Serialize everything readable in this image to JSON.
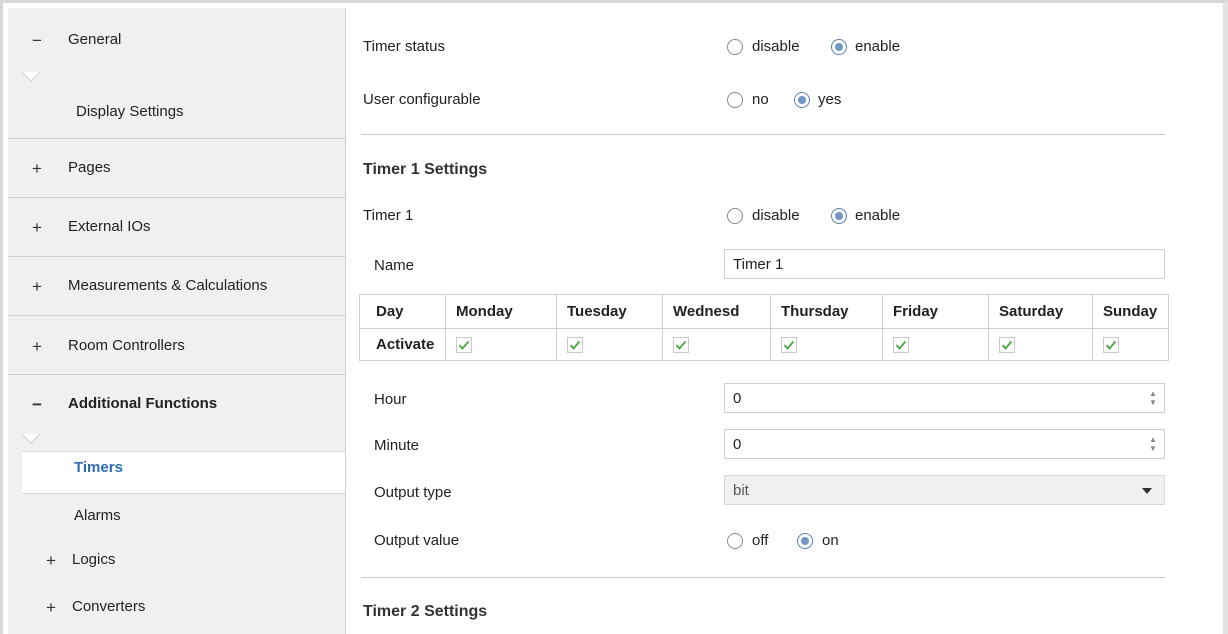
{
  "sidebar": {
    "items": [
      {
        "symbol": "−",
        "label": "General"
      },
      {
        "symbol": "",
        "label": "Display Settings"
      },
      {
        "symbol": "+",
        "label": "Pages"
      },
      {
        "symbol": "+",
        "label": "External IOs"
      },
      {
        "symbol": "+",
        "label": "Measurements & Calculations"
      },
      {
        "symbol": "+",
        "label": "Room Controllers"
      },
      {
        "symbol": "−",
        "label": "Additional Functions"
      },
      {
        "symbol": "",
        "label": "Timers"
      },
      {
        "symbol": "",
        "label": "Alarms"
      },
      {
        "symbol": "+",
        "label": "Logics"
      },
      {
        "symbol": "+",
        "label": "Converters"
      }
    ],
    "selected": "Timers"
  },
  "main": {
    "timer_status": {
      "label": "Timer status",
      "opt_a": "disable",
      "opt_b": "enable",
      "selected": "enable"
    },
    "user_configurable": {
      "label": "User configurable",
      "opt_a": "no",
      "opt_b": "yes",
      "selected": "yes"
    },
    "timer1_section": "Timer 1 Settings",
    "timer1": {
      "label": "Timer 1",
      "opt_a": "disable",
      "opt_b": "enable",
      "selected": "enable"
    },
    "name": {
      "label": "Name",
      "value": "Timer 1"
    },
    "days_table": {
      "headers": [
        "Day",
        "Monday",
        "Tuesday",
        "Wednesd",
        "Thursday",
        "Friday",
        "Saturday",
        "Sunday"
      ],
      "row_label": "Activate",
      "checked": [
        true,
        true,
        true,
        true,
        true,
        true,
        true
      ]
    },
    "hour": {
      "label": "Hour",
      "value": "0"
    },
    "minute": {
      "label": "Minute",
      "value": "0"
    },
    "output_type": {
      "label": "Output type",
      "value": "bit"
    },
    "output_value": {
      "label": "Output value",
      "opt_a": "off",
      "opt_b": "on",
      "selected": "on"
    },
    "timer2_section": "Timer 2 Settings"
  },
  "colors": {
    "accent": "#2e6db4",
    "radio_fill": "#6f97c4",
    "check": "#4aa63e",
    "sidebar_bg": "#f0f0f0"
  }
}
